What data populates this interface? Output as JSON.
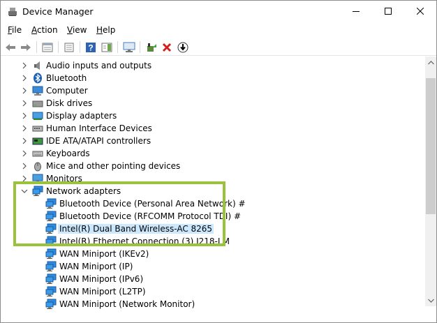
{
  "window": {
    "title": "Device Manager"
  },
  "menu": [
    {
      "mnemonic": "F",
      "rest": "ile"
    },
    {
      "mnemonic": "A",
      "rest": "ction"
    },
    {
      "mnemonic": "V",
      "rest": "iew"
    },
    {
      "mnemonic": "H",
      "rest": "elp"
    }
  ],
  "toolbar": {
    "icons": [
      "back-arrow-icon",
      "forward-arrow-icon",
      "properties-sheet-icon",
      "show-hide-tree-icon",
      "help-icon",
      "action-pane-icon",
      "computer-monitor-icon",
      "update-driver-icon",
      "uninstall-x-icon",
      "download-arrow-icon"
    ]
  },
  "tree": {
    "categories": [
      {
        "label": "Audio inputs and outputs",
        "icon": "speaker-icon"
      },
      {
        "label": "Bluetooth",
        "icon": "bluetooth-icon"
      },
      {
        "label": "Computer",
        "icon": "computer-icon"
      },
      {
        "label": "Disk drives",
        "icon": "disk-drive-icon"
      },
      {
        "label": "Display adapters",
        "icon": "display-adapter-icon"
      },
      {
        "label": "Human Interface Devices",
        "icon": "hid-icon"
      },
      {
        "label": "IDE ATA/ATAPI controllers",
        "icon": "ide-controller-icon"
      },
      {
        "label": "Keyboards",
        "icon": "keyboard-icon"
      },
      {
        "label": "Mice and other pointing devices",
        "icon": "mouse-icon"
      },
      {
        "label": "Monitors",
        "icon": "monitor-icon"
      }
    ],
    "expanded": {
      "label": "Network adapters",
      "icon": "network-adapter-icon",
      "children": [
        {
          "label": "Bluetooth Device (Personal Area Network) #",
          "selected": false
        },
        {
          "label": "Bluetooth Device (RFCOMM Protocol TDI) #",
          "selected": false
        },
        {
          "label": "Intel(R) Dual Band Wireless-AC 8265",
          "selected": true
        },
        {
          "label": "Intel(R) Ethernet Connection (3) I218-LM",
          "selected": false
        },
        {
          "label": "WAN Miniport (IKEv2)",
          "selected": false
        },
        {
          "label": "WAN Miniport (IP)",
          "selected": false
        },
        {
          "label": "WAN Miniport (IPv6)",
          "selected": false
        },
        {
          "label": "WAN Miniport (L2TP)",
          "selected": false
        },
        {
          "label": "WAN Miniport (Network Monitor)",
          "selected": false
        }
      ]
    }
  },
  "colors": {
    "highlight_border": "#9bc23c",
    "selection": "#cce8ff",
    "network_icon": "#1e7fd0"
  }
}
